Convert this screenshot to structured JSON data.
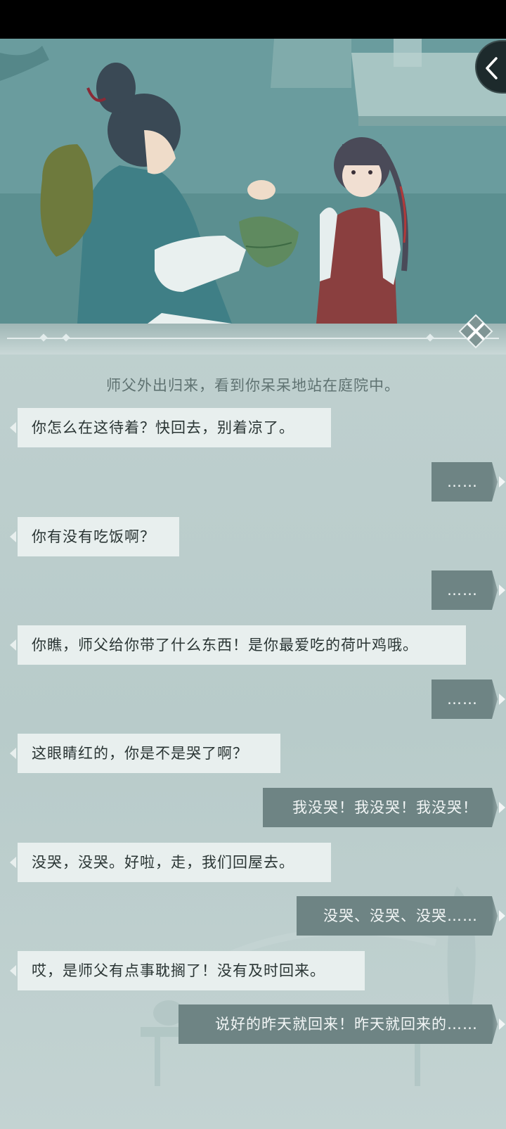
{
  "narration": "师父外出归来，看到你呆呆地站在庭院中。",
  "messages": [
    {
      "side": "left",
      "text": "你怎么在这待着？快回去，别着凉了。"
    },
    {
      "side": "right",
      "text": "……"
    },
    {
      "side": "left",
      "text": "你有没有吃饭啊？"
    },
    {
      "side": "right",
      "text": "……"
    },
    {
      "side": "left",
      "text": "你瞧，师父给你带了什么东西！是你最爱吃的荷叶鸡哦。"
    },
    {
      "side": "right",
      "text": "……"
    },
    {
      "side": "left",
      "text": "这眼睛红的，你是不是哭了啊？"
    },
    {
      "side": "right",
      "text": "我没哭！我没哭！我没哭！"
    },
    {
      "side": "left",
      "text": "没哭，没哭。好啦，走，我们回屋去。"
    },
    {
      "side": "right",
      "text": "没哭、没哭、没哭……"
    },
    {
      "side": "left",
      "text": "哎，是师父有点事耽搁了！没有及时回来。"
    },
    {
      "side": "right",
      "text": "说好的昨天就回来！昨天就回来的……"
    }
  ],
  "icons": {
    "back": "chevron-left-icon",
    "close": "close-icon"
  },
  "colors": {
    "panel": "#b9cccb",
    "left_bubble": "#e8efee",
    "right_bubble": "#6e8484"
  }
}
